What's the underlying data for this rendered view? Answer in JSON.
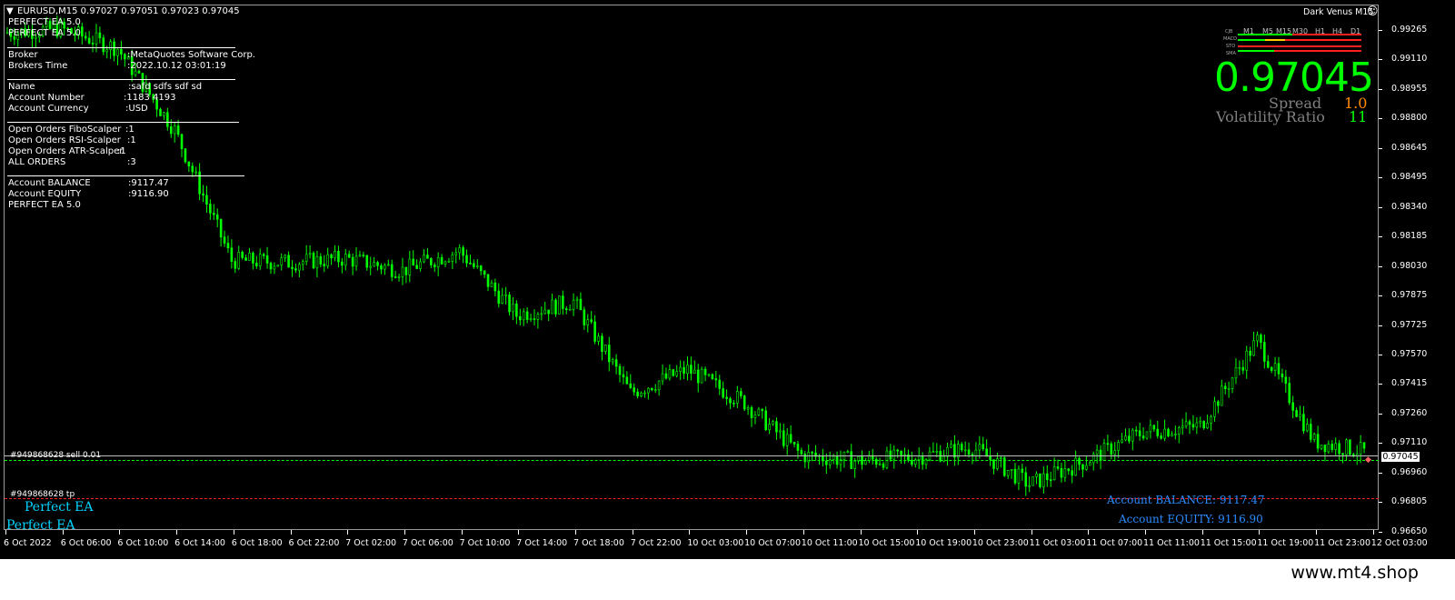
{
  "header": {
    "symbol_line": "EURUSD,M15  0.97027 0.97051 0.97023 0.97045",
    "indicator_name": "Dark Venus M15",
    "ea_title_1": "PERFECT EA 5.0",
    "ea_title_2": "PERFECT EA 5.0"
  },
  "info_panel": {
    "broker_label": "Broker",
    "broker_value": ":MetaQuotes Software Corp.",
    "time_label": "Brokers Time",
    "time_value": ":2022.10.12 03:01:19",
    "name_label": "Name",
    "name_value": ":safd    sdfs sdf  sd",
    "account_number_label": "Account Number",
    "account_number_value": ":1183 4193",
    "currency_label": "Account Currency",
    "currency_value": ":USD",
    "fibo_label": "Open Orders FiboScalper",
    "fibo_value": ":1",
    "rsi_label": "Open Orders RSI-Scalper",
    "rsi_value": ":1",
    "atr_label": "Open Orders ATR-Scalper",
    "atr_value": ":1",
    "all_label": "ALL ORDERS",
    "all_value": ":3",
    "balance_label": "Account BALANCE",
    "balance_value": ":9117.47",
    "equity_label": "Account EQUITY",
    "equity_value": ":9116.90",
    "footer_title": "PERFECT EA 5.0"
  },
  "quote_panel": {
    "price": "0.97045",
    "spread_label": "Spread",
    "spread_value": "1.0",
    "volatility_label": "Volatility Ratio",
    "volatility_value": "11",
    "timeframes": [
      "M1",
      "M5",
      "M15",
      "M30",
      "H1",
      "H4",
      "D1"
    ],
    "mini_rows": [
      "CJB",
      "MACD",
      "STO",
      "SMA"
    ]
  },
  "orders": {
    "sell_label": "#949868628 sell 0.01",
    "tp_label": "#949868628 tp"
  },
  "overlay": {
    "perfect_ea_1": "Perfect EA",
    "perfect_ea_2": "Perfect EA",
    "balance_text": "Account BALANCE:  9117.47",
    "equity_text": "Account EQUITY:  9116.90"
  },
  "price_axis": {
    "current_price": "0.97045",
    "ticks": [
      "0.99265",
      "0.99110",
      "0.98955",
      "0.98800",
      "0.98645",
      "0.98495",
      "0.98340",
      "0.98185",
      "0.98030",
      "0.97875",
      "0.97725",
      "0.97570",
      "0.97415",
      "0.97260",
      "0.97110",
      "0.96960",
      "0.96805",
      "0.96650"
    ]
  },
  "time_axis": {
    "ticks": [
      "6 Oct 2022",
      "6 Oct 06:00",
      "6 Oct 10:00",
      "6 Oct 14:00",
      "6 Oct 18:00",
      "6 Oct 22:00",
      "7 Oct 02:00",
      "7 Oct 06:00",
      "7 Oct 10:00",
      "7 Oct 14:00",
      "7 Oct 18:00",
      "7 Oct 22:00",
      "10 Oct 03:00",
      "10 Oct 07:00",
      "10 Oct 11:00",
      "10 Oct 15:00",
      "10 Oct 19:00",
      "10 Oct 23:00",
      "11 Oct 03:00",
      "11 Oct 07:00",
      "11 Oct 11:00",
      "11 Oct 15:00",
      "11 Oct 19:00",
      "11 Oct 23:00",
      "12 Oct 03:00"
    ]
  },
  "chart_data": {
    "type": "line",
    "symbol": "EURUSD",
    "timeframe": "M15",
    "ylim": [
      0.9665,
      0.9934
    ],
    "y_ticks": [
      0.99265,
      0.9911,
      0.98955,
      0.988,
      0.98645,
      0.98495,
      0.9834,
      0.98185,
      0.9803,
      0.97875,
      0.97725,
      0.9757,
      0.97415,
      0.9726,
      0.9711,
      0.9696,
      0.96805,
      0.9665
    ],
    "x": [
      "6 Oct 2022",
      "6 Oct 06:00",
      "6 Oct 10:00",
      "6 Oct 14:00",
      "6 Oct 18:00",
      "6 Oct 22:00",
      "7 Oct 02:00",
      "7 Oct 06:00",
      "7 Oct 10:00",
      "7 Oct 14:00",
      "7 Oct 18:00",
      "7 Oct 22:00",
      "10 Oct 03:00",
      "10 Oct 07:00",
      "10 Oct 11:00",
      "10 Oct 15:00",
      "10 Oct 19:00",
      "10 Oct 23:00",
      "11 Oct 03:00",
      "11 Oct 07:00",
      "11 Oct 11:00",
      "11 Oct 15:00",
      "11 Oct 19:00",
      "11 Oct 23:00",
      "12 Oct 03:00"
    ],
    "series": [
      {
        "values": [
          0.992,
          0.9922,
          0.9912,
          0.987,
          0.9803,
          0.9802,
          0.9804,
          0.9798,
          0.9808,
          0.9775,
          0.9782,
          0.9735,
          0.9747,
          0.973,
          0.9703,
          0.97,
          0.9702,
          0.9707,
          0.9688,
          0.97,
          0.9715,
          0.9718,
          0.9762,
          0.971,
          0.9704
        ]
      }
    ],
    "order_levels": {
      "sell": 0.97045,
      "tp": 0.96825
    },
    "colors": {
      "candle": "#00ff00",
      "sell_line": "#00ff00",
      "tp_line": "#ff2020",
      "bid_line": "#c0c0c0"
    }
  }
}
